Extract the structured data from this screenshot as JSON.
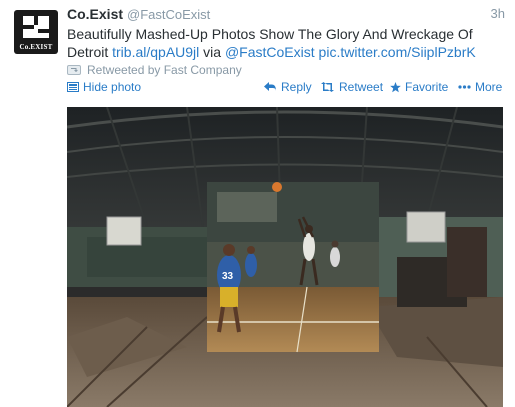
{
  "tweet": {
    "avatar_text": "Co.EXIST",
    "name": "Co.Exist",
    "handle": "@FastCoExist",
    "time": "3h",
    "text_main": "Beautifully Mashed-Up Photos Show The Glory And Wreckage Of Detroit ",
    "link1": "trib.al/qpAU9jl",
    "text_via": " via ",
    "mention": "@FastCoExist",
    "link2": "pic.twitter.com/SiiplPzbrK"
  },
  "retweeted_by": "Retweeted by Fast Company",
  "actions": {
    "hide_photo": "Hide photo",
    "reply": "Reply",
    "retweet": "Retweet",
    "favorite": "Favorite",
    "more": "More"
  },
  "photo": {
    "jersey_number": "33"
  },
  "colors": {
    "link": "#2a7cc7",
    "muted": "#8899a6",
    "text": "#292f33"
  }
}
